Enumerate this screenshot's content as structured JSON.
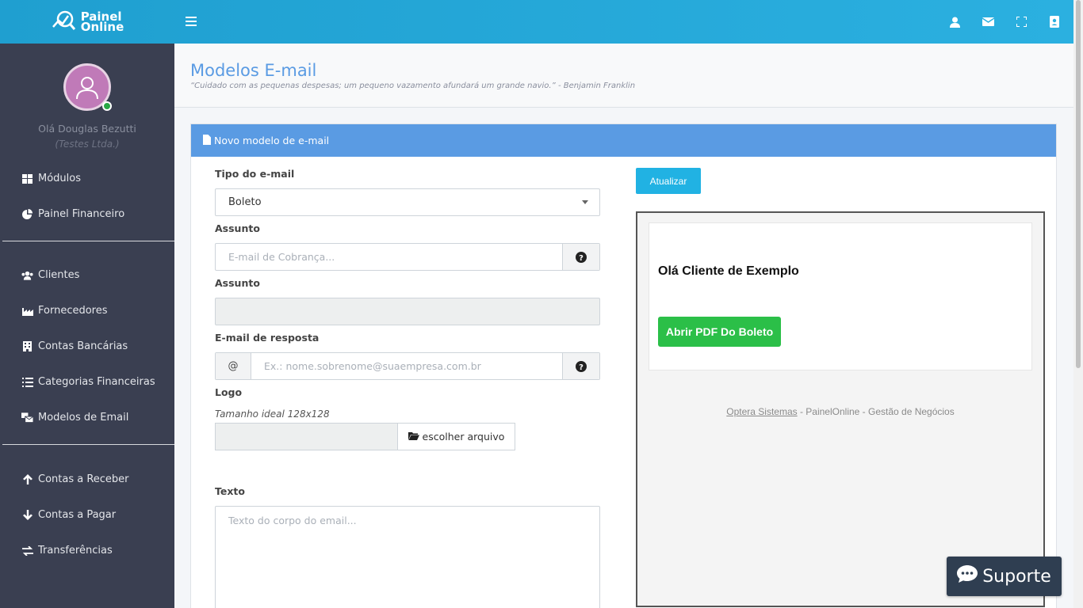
{
  "brand": {
    "line1": "Painel",
    "line2": "Online"
  },
  "header": {
    "icons": [
      "user-icon",
      "envelope-icon",
      "expand-icon",
      "address-book-icon"
    ]
  },
  "sidebar": {
    "user_name": "Olá Douglas Bezutti",
    "company": "(Testes Ltda.)",
    "group1": [
      {
        "label": "Módulos",
        "icon": "grid-icon"
      },
      {
        "label": "Painel Financeiro",
        "icon": "pie-chart-icon"
      }
    ],
    "group2": [
      {
        "label": "Clientes",
        "icon": "users-icon"
      },
      {
        "label": "Fornecedores",
        "icon": "industry-icon"
      },
      {
        "label": "Contas Bancárias",
        "icon": "building-icon"
      },
      {
        "label": "Categorias Financeiras",
        "icon": "list-icon"
      },
      {
        "label": "Modelos de Email",
        "icon": "mail-bulk-icon"
      }
    ],
    "group3": [
      {
        "label": "Contas a Receber",
        "icon": "arrow-up-icon"
      },
      {
        "label": "Contas a Pagar",
        "icon": "arrow-down-icon"
      },
      {
        "label": "Transferências",
        "icon": "exchange-icon"
      }
    ]
  },
  "page": {
    "title": "Modelos E-mail",
    "quote": "“Cuidado com as pequenas despesas; um pequeno vazamento afundará um grande navio.” - Benjamin Franklin"
  },
  "card": {
    "header": "Novo modelo de e-mail"
  },
  "form": {
    "tipo_label": "Tipo do e-mail",
    "tipo_value": "Boleto",
    "assunto_label": "Assunto",
    "assunto_placeholder": "E-mail de Cobrança...",
    "assunto2_label": "Assunto",
    "resposta_label": "E-mail de resposta",
    "resposta_prefix": "@",
    "resposta_placeholder": "Ex.: nome.sobrenome@suaempresa.com.br",
    "logo_label": "Logo",
    "logo_hint": "Tamanho ideal 128x128",
    "file_button": "escolher arquivo",
    "texto_label": "Texto",
    "texto_placeholder": "Texto do corpo do email..."
  },
  "preview": {
    "update_button": "Atualizar",
    "greeting": "Olá Cliente de Exemplo",
    "cta": "Abrir PDF Do Boleto",
    "footer_link": "Optera Sistemas",
    "footer_rest": " - PainelOnline - Gestão de Negócios"
  },
  "support": {
    "label": "Suporte"
  },
  "colors": {
    "header": "#2bb0e0",
    "sidebar": "#3a3f51",
    "accent": "#5a9be3",
    "button": "#21b2e3",
    "cta": "#2bbf48",
    "support": "#2f3e51"
  }
}
